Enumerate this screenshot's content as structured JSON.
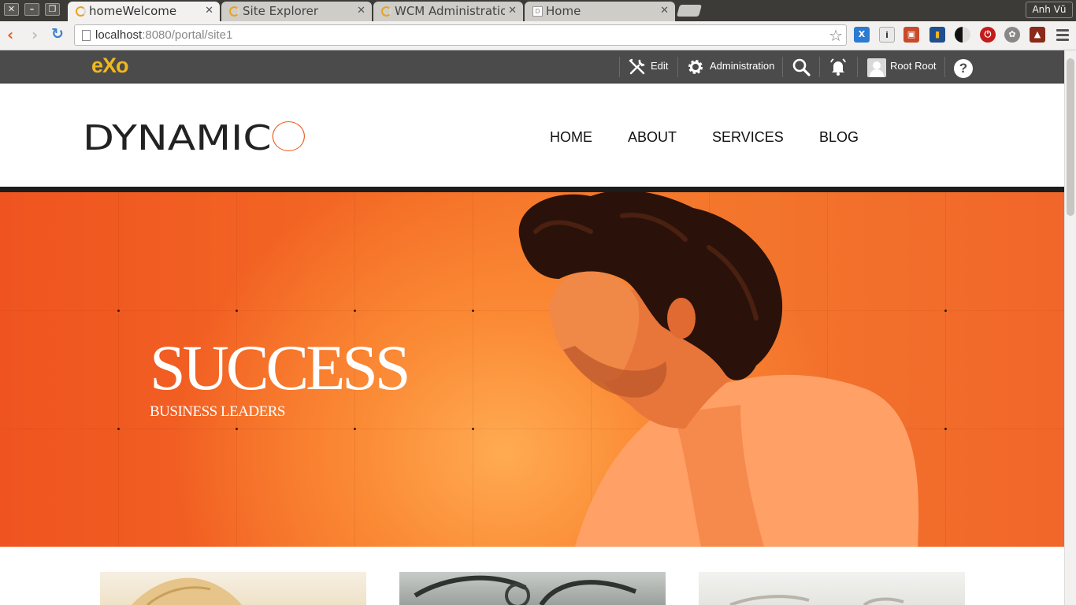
{
  "browser": {
    "tabs": [
      {
        "title": "homeWelcome",
        "active": true,
        "icon": "loading-spinner-icon"
      },
      {
        "title": "Site Explorer",
        "active": false,
        "icon": "loading-spinner-icon"
      },
      {
        "title": "WCM Administration",
        "active": false,
        "icon": "loading-spinner-icon"
      },
      {
        "title": "Home",
        "active": false,
        "icon": "page-favicon-icon"
      }
    ],
    "user": "Anh Vũ",
    "url_host": "localhost",
    "url_rest": ":8080/portal/site1"
  },
  "exo_toolbar": {
    "logo": "eXo",
    "edit_label": "Edit",
    "administration_label": "Administration",
    "user_name": "Root Root",
    "help_label": "?"
  },
  "site": {
    "brand": "DYNAMIC",
    "nav": [
      "HOME",
      "ABOUT",
      "SERVICES",
      "BLOG"
    ],
    "hero_title": "SUCCESS",
    "hero_subtitle": "BUSINESS LEADERS",
    "accent_color": "#f05a1a"
  }
}
